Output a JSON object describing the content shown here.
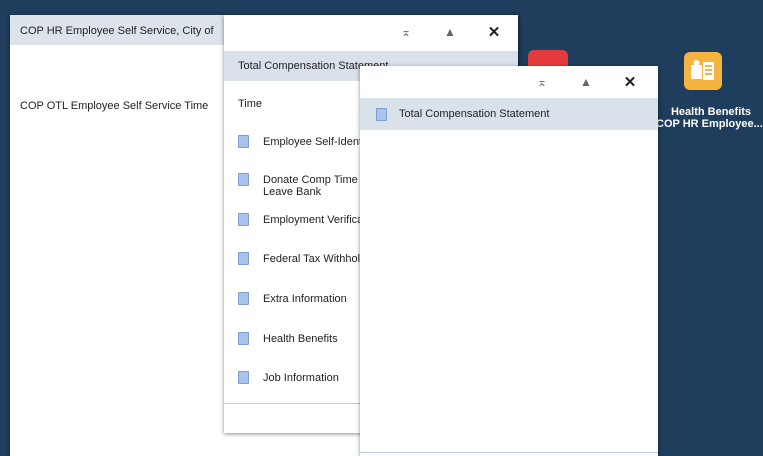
{
  "background": {
    "tile_health_label": "Health Benefits",
    "tile_health_sub": "COP HR Employee..."
  },
  "window1": {
    "items": [
      "COP HR Employee Self Service, City of",
      "COP OTL Employee Self Service Time"
    ]
  },
  "window2": {
    "selected": "Total Compensation Statement",
    "section": "Time",
    "items": [
      "Employee Self-Identification",
      "Donate Comp Time",
      "Employment Verification",
      "Federal Tax Withholding",
      "Extra Information",
      "Health Benefits",
      "Job Information"
    ],
    "donate_line2": "Leave Bank"
  },
  "window3": {
    "selected": "Total Compensation Statement"
  },
  "controls": {
    "top": "⌅",
    "up": "▲",
    "close": "✕"
  },
  "colors": {
    "desktop": "#1f3d5c",
    "tile_orange": "#f4b43f",
    "tile_red": "#e33b3b",
    "selected_row": "#d9e1eb"
  }
}
